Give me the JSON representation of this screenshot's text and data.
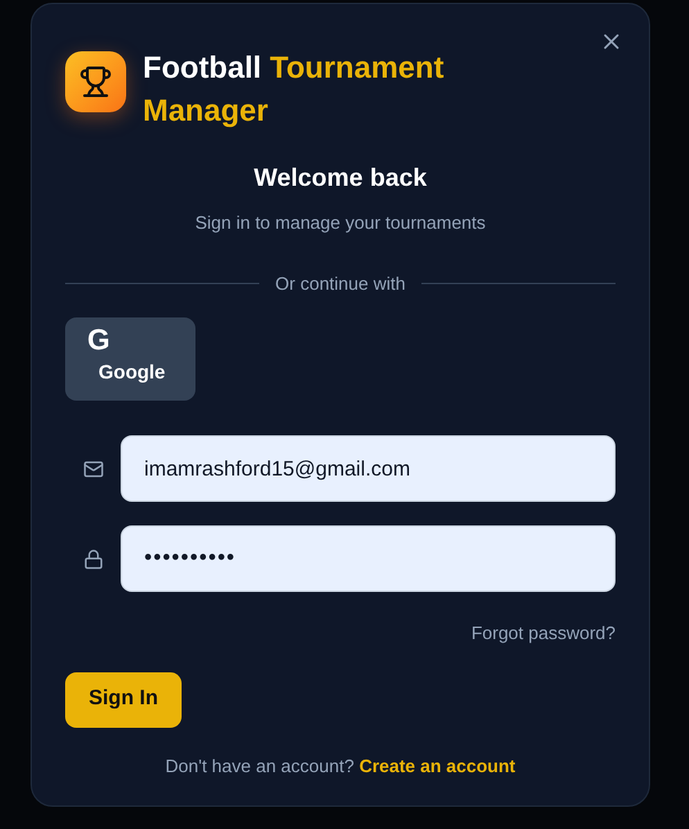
{
  "dialog": {
    "title": [
      {
        "text": "Football",
        "kind": "plain"
      },
      {
        "text": "Tournament Manager",
        "kind": "accent"
      }
    ],
    "heading": "Welcome back",
    "subheading": "Sign in to manage your tournaments",
    "divider_text": "Or continue with",
    "social_buttons": [
      {
        "label": "Google",
        "icon_letter": "G"
      }
    ],
    "fields": [
      {
        "kind": "email",
        "value": "imamrashford15@gmail.com"
      },
      {
        "kind": "password",
        "value": "••••••••••"
      }
    ],
    "forgot_link": "Forgot password?",
    "submit": "Sign In",
    "footer": {
      "text": "Don't have an account?",
      "link": "Create an account"
    }
  }
}
